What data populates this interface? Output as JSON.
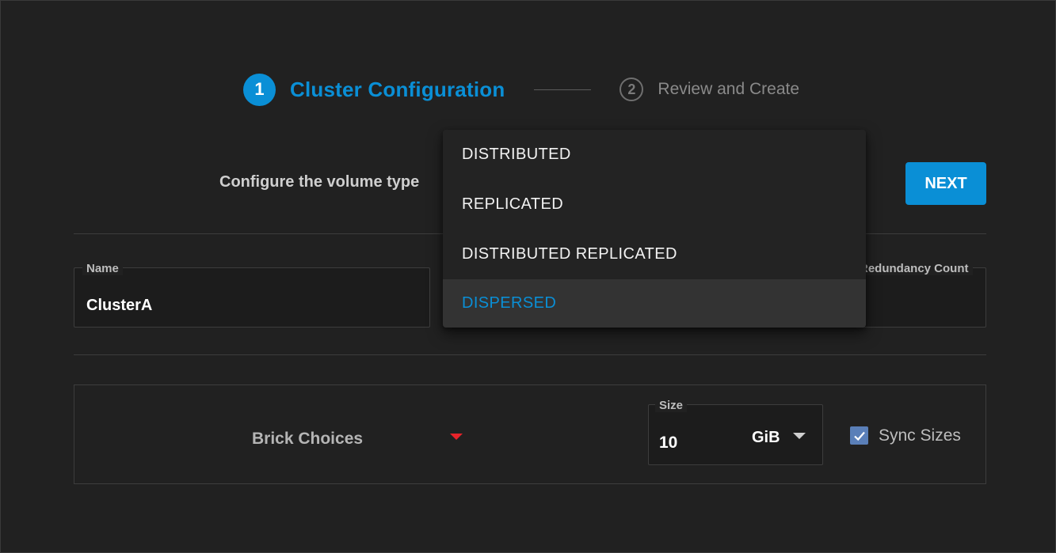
{
  "stepper": {
    "steps": [
      {
        "number": "1",
        "label": "Cluster Configuration",
        "state": "active"
      },
      {
        "number": "2",
        "label": "Review and Create",
        "state": "inactive"
      }
    ]
  },
  "header": {
    "instruction": "Configure the volume type",
    "next_label": "NEXT"
  },
  "form": {
    "name": {
      "label": "Name",
      "value": "ClusterA"
    },
    "redundancy": {
      "label": "Redundancy Count"
    }
  },
  "volume_type_menu": {
    "options": [
      "DISTRIBUTED",
      "REPLICATED",
      "DISTRIBUTED REPLICATED",
      "DISPERSED"
    ],
    "selected": "DISPERSED"
  },
  "bricks": {
    "choices_label": "Brick Choices",
    "size": {
      "label": "Size",
      "value": "10",
      "unit": "GiB"
    },
    "sync_sizes": {
      "label": "Sync Sizes",
      "checked": true
    }
  },
  "colors": {
    "accent": "#0a8fd6",
    "background": "#212121",
    "error_arrow": "#e8232a",
    "checkbox": "#5a7fb8"
  }
}
